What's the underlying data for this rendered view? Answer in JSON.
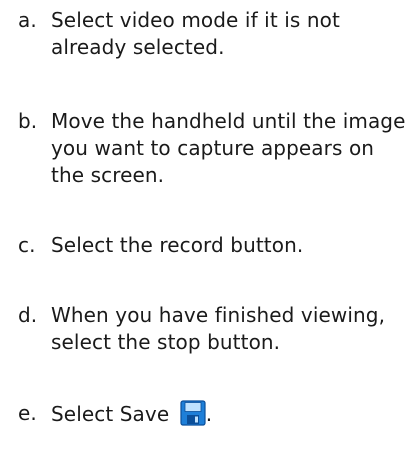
{
  "steps": [
    {
      "letter": "a.",
      "text": "Select video mode if it is not already selected."
    },
    {
      "letter": "b.",
      "text": "Move the handheld until the image you want to capture appears on the screen."
    },
    {
      "letter": "c.",
      "text": "Select the record button."
    },
    {
      "letter": "d.",
      "text": "When you have finished viewing, select the stop button."
    },
    {
      "letter": "e.",
      "text": "Select Save",
      "suffix": ".",
      "icon": "save-icon"
    }
  ],
  "colors": {
    "text": "#1a1a1a",
    "icon_blue": "#1e7fd8",
    "icon_blue_dark": "#0b4f9a",
    "icon_light": "#bfe2ff"
  }
}
